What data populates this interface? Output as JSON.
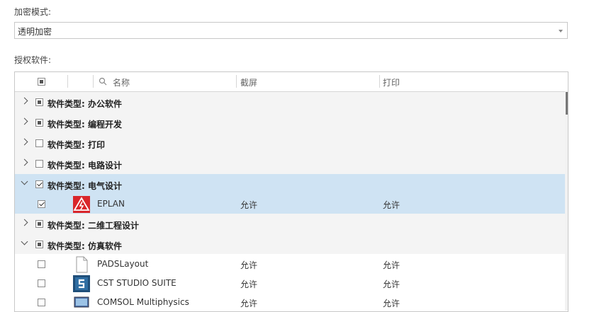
{
  "encryption": {
    "label": "加密模式:",
    "selected": "透明加密"
  },
  "software": {
    "label": "授权软件:",
    "columns": {
      "name_placeholder": "名称",
      "screenshot": "截屏",
      "print": "打印"
    },
    "groups": [
      {
        "title": "软件类型: 办公软件",
        "expanded": false,
        "check": "partial"
      },
      {
        "title": "软件类型: 编程开发",
        "expanded": false,
        "check": "partial"
      },
      {
        "title": "软件类型: 打印",
        "expanded": false,
        "check": "unchecked"
      },
      {
        "title": "软件类型: 电路设计",
        "expanded": false,
        "check": "unchecked"
      },
      {
        "title": "软件类型: 电气设计",
        "expanded": true,
        "check": "checked"
      },
      {
        "title": "软件类型: 二维工程设计",
        "expanded": false,
        "check": "partial"
      },
      {
        "title": "软件类型: 仿真软件",
        "expanded": true,
        "check": "partial"
      }
    ],
    "items": [
      {
        "name": "EPLAN",
        "screenshot": "允许",
        "print": "允许",
        "checked": true,
        "icon": "eplan-icon"
      },
      {
        "name": "PADSLayout",
        "screenshot": "允许",
        "print": "允许",
        "checked": false,
        "icon": "file-icon"
      },
      {
        "name": "CST STUDIO SUITE",
        "screenshot": "允许",
        "print": "允许",
        "checked": false,
        "icon": "cst-icon"
      },
      {
        "name": "COMSOL Multiphysics",
        "screenshot": "允许",
        "print": "允许",
        "checked": false,
        "icon": "comsol-icon"
      }
    ]
  },
  "colors": {
    "selected_row": "#cfe3f3",
    "group_row": "#f4f4f4",
    "eplan_red": "#d9262b"
  }
}
